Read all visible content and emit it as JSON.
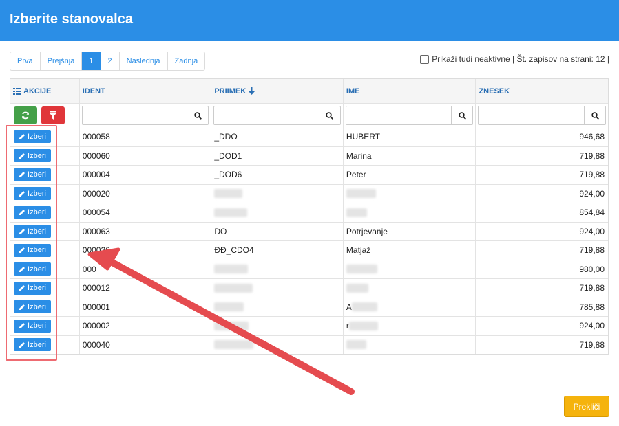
{
  "header": {
    "title": "Izberite stanovalca",
    "color": "#2b8ee6"
  },
  "pagination": {
    "items": [
      {
        "label": "Prva",
        "active": false
      },
      {
        "label": "Prejšnja",
        "active": false
      },
      {
        "label": "1",
        "active": true
      },
      {
        "label": "2",
        "active": false
      },
      {
        "label": "Naslednja",
        "active": false
      },
      {
        "label": "Zadnja",
        "active": false
      }
    ]
  },
  "options": {
    "show_inactive_label": "Prikaži tudi neaktivne | Št. zapisov na strani: 12 |",
    "show_inactive_checked": false
  },
  "table": {
    "columns": [
      {
        "label": "AKCIJE",
        "icon": "list-icon"
      },
      {
        "label": "IDENT"
      },
      {
        "label": "PRIIMEK",
        "icon": "sort-down-arrow-icon"
      },
      {
        "label": "IME"
      },
      {
        "label": "ZNESEK"
      }
    ],
    "row_button_label": "Izberi",
    "rows": [
      {
        "ident": "000058",
        "priimek": "_DDO",
        "ime": "HUBERT",
        "znesek": "946,68"
      },
      {
        "ident": "000060",
        "priimek": "_DOD1",
        "ime": "Marina",
        "znesek": "719,88"
      },
      {
        "ident": "000004",
        "priimek": "_DOD6",
        "ime": "Peter",
        "znesek": "719,88"
      },
      {
        "ident": "000020",
        "priimek": "",
        "ime": "",
        "znesek": "924,00"
      },
      {
        "ident": "000054",
        "priimek": "",
        "ime": "",
        "znesek": "854,84"
      },
      {
        "ident": "000063",
        "priimek": "DO",
        "ime": "Potrjevanje",
        "znesek": "924,00"
      },
      {
        "ident": "000026",
        "priimek": "ĐĐ_CDO4",
        "ime": "Matjaž",
        "znesek": "719,88"
      },
      {
        "ident": "000",
        "priimek": "",
        "ime": "",
        "znesek": "980,00"
      },
      {
        "ident": "000012",
        "priimek": "",
        "ime": "",
        "znesek": "719,88"
      },
      {
        "ident": "000001",
        "priimek": "",
        "ime": "A",
        "znesek": "785,88"
      },
      {
        "ident": "000002",
        "priimek": "",
        "ime": "r",
        "znesek": "924,00"
      },
      {
        "ident": "000040",
        "priimek": "",
        "ime": "",
        "znesek": "719,88"
      }
    ]
  },
  "footer": {
    "cancel_label": "Prekliči",
    "cancel_color": "#f5b30d"
  },
  "annotation": {
    "color": "#ee4b55"
  }
}
